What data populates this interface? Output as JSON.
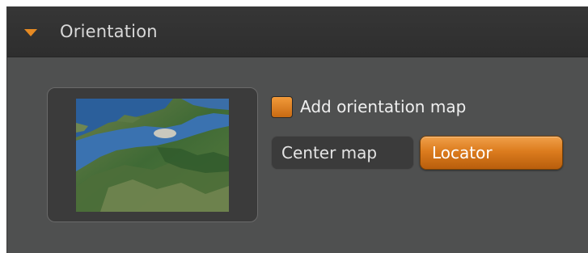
{
  "section": {
    "title": "Orientation",
    "expanded": true,
    "caret_icon": "triangle-down-icon",
    "accent_color": "#e68a23"
  },
  "thumbnail": {
    "icon": "map-thumbnail"
  },
  "options": {
    "add_map_label": "Add orientation map",
    "add_map_checked": true
  },
  "mode_buttons": {
    "center_label": "Center map",
    "locator_label": "Locator",
    "selected": "Locator"
  }
}
